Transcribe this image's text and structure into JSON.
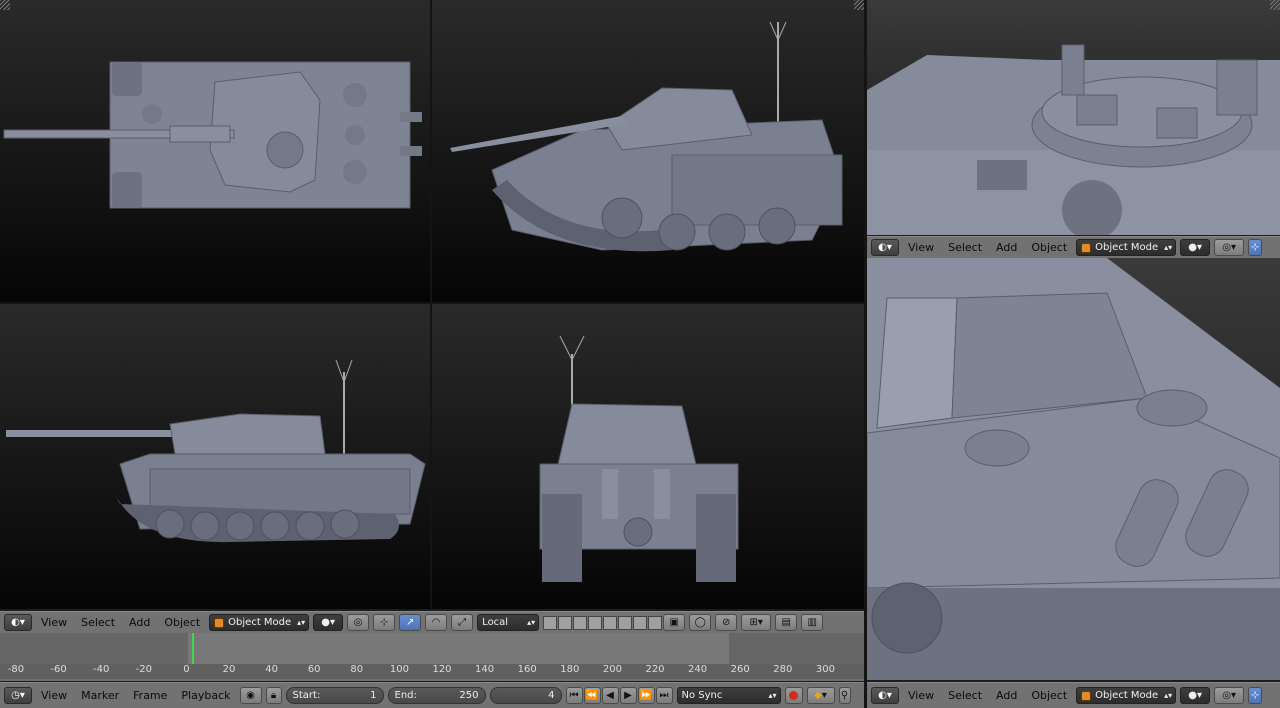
{
  "viewport_header_menus": [
    "View",
    "Select",
    "Add",
    "Object"
  ],
  "object_mode_label": "Object Mode",
  "transform_orientation": "Local",
  "timeline": {
    "menus": [
      "View",
      "Marker",
      "Frame",
      "Playback"
    ],
    "start_label": "Start:",
    "start_value": "1",
    "end_label": "End:",
    "end_value": "250",
    "current_frame": "4",
    "sync_mode": "No Sync",
    "ruler_ticks": [
      "-80",
      "-60",
      "-40",
      "-20",
      "0",
      "20",
      "40",
      "60",
      "80",
      "100",
      "120",
      "140",
      "160",
      "180",
      "200",
      "220",
      "240",
      "260",
      "280",
      "300"
    ]
  },
  "colors": {
    "model_gray": "#7f8494",
    "header_bg": "#727272",
    "frame_cursor": "#3bdc46"
  }
}
